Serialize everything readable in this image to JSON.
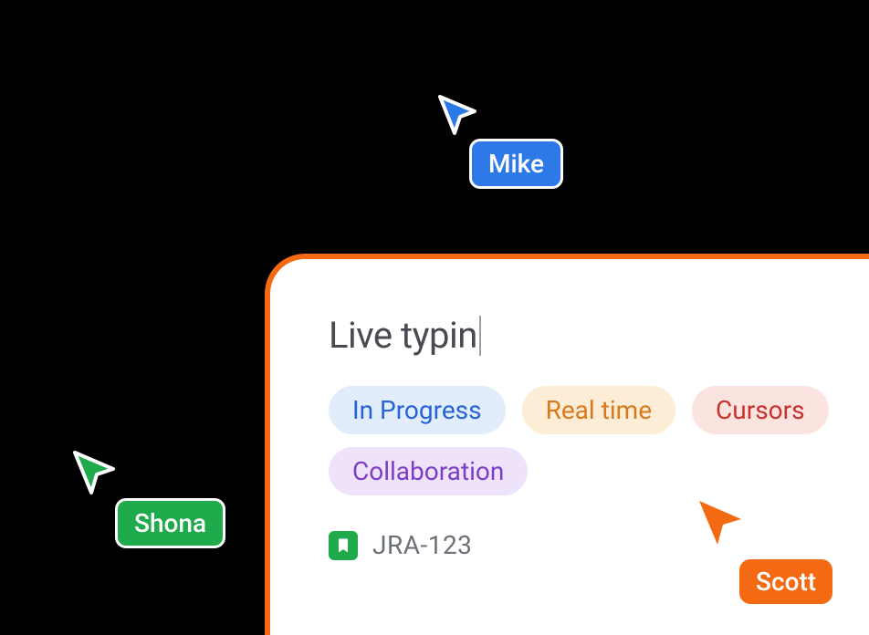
{
  "card": {
    "typing_text": "Live typin",
    "tags": [
      {
        "label": "In Progress"
      },
      {
        "label": "Real time"
      },
      {
        "label": "Cursors"
      },
      {
        "label": "Collaboration"
      }
    ],
    "reference": {
      "id": "JRA-123",
      "icon_name": "bookmark-icon"
    }
  },
  "cursors": {
    "mike": {
      "name": "Mike",
      "color": "#2e79e8"
    },
    "shona": {
      "name": "Shona",
      "color": "#1faa4b"
    },
    "scott": {
      "name": "Scott",
      "color": "#f46a12"
    }
  },
  "colors": {
    "card_border": "#f46a12",
    "tag_in_progress_bg": "#e2edfc",
    "tag_in_progress_fg": "#2663d8",
    "tag_real_time_bg": "#fdedd6",
    "tag_real_time_fg": "#d77a1e",
    "tag_cursors_bg": "#fbe3e0",
    "tag_cursors_fg": "#c9322c",
    "tag_collab_bg": "#efe3fb",
    "tag_collab_fg": "#7c3ec7"
  }
}
